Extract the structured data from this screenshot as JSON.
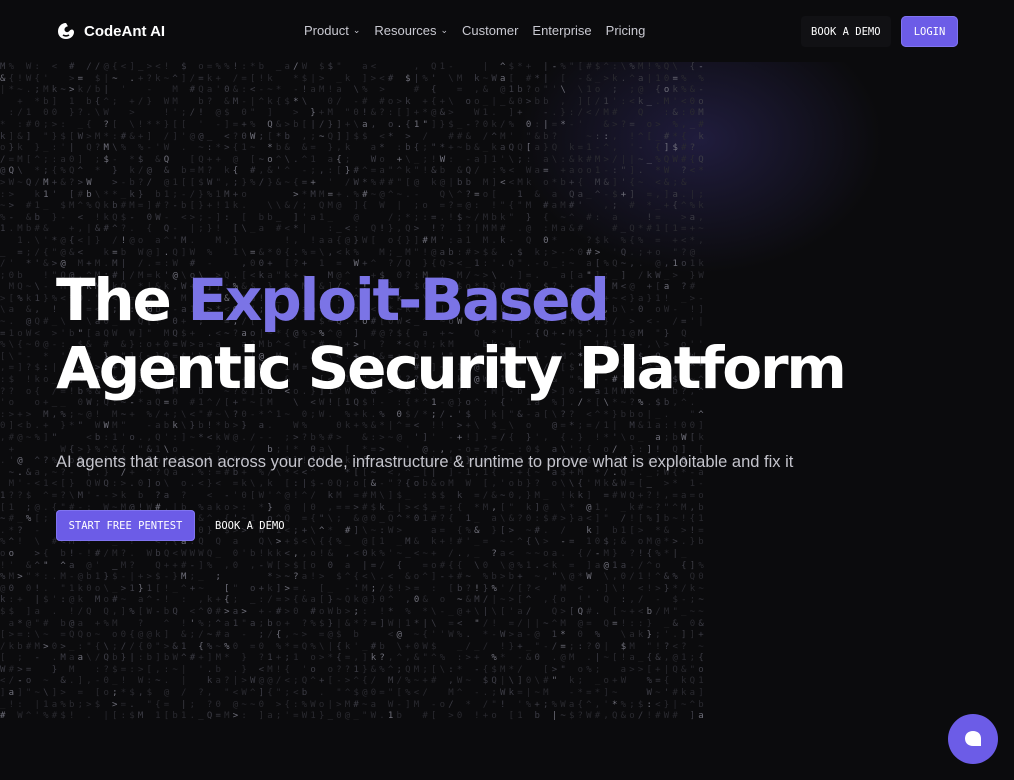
{
  "header": {
    "brand": "CodeAnt AI",
    "nav": [
      {
        "label": "Product",
        "has_dropdown": true
      },
      {
        "label": "Resources",
        "has_dropdown": true
      },
      {
        "label": "Customer",
        "has_dropdown": false
      },
      {
        "label": "Enterprise",
        "has_dropdown": false
      },
      {
        "label": "Pricing",
        "has_dropdown": false
      }
    ],
    "book_demo_label": "BOOK A DEMO",
    "login_label": "LOGIN"
  },
  "hero": {
    "headline_prefix": "The",
    "headline_accent": "Exploit-Based",
    "headline_line2": "Agentic Security Platform",
    "subtitle": "AI agents that reason across your code, infrastructure & runtime to prove what is exploitable and fix it",
    "primary_cta": "START FREE PENTEST",
    "secondary_cta": "BOOK A DEMO"
  },
  "chat_widget": {
    "icon": "chat-bubble-icon"
  },
  "colors": {
    "background": "#0b0b0d",
    "accent": "#6c5ce7",
    "headline_accent": "#7b74e6",
    "text_primary": "#ffffff",
    "text_secondary": "#c4c4cc"
  }
}
